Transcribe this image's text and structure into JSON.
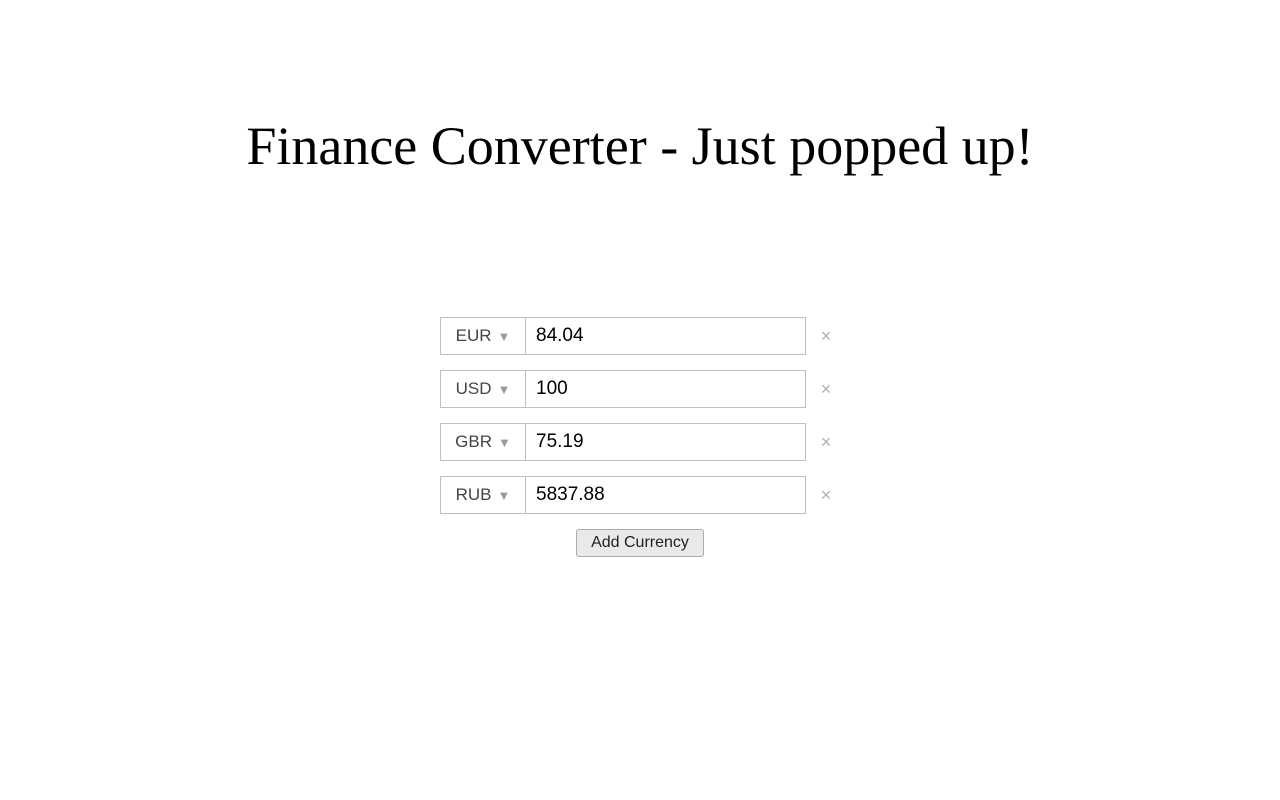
{
  "title": "Finance Converter - Just popped up!",
  "rows": [
    {
      "currency": "EUR",
      "value": "84.04"
    },
    {
      "currency": "USD",
      "value": "100"
    },
    {
      "currency": "GBR",
      "value": "75.19"
    },
    {
      "currency": "RUB",
      "value": "5837.88"
    }
  ],
  "buttons": {
    "add_currency": "Add Currency"
  },
  "glyphs": {
    "caret": "▼",
    "close": "×"
  }
}
